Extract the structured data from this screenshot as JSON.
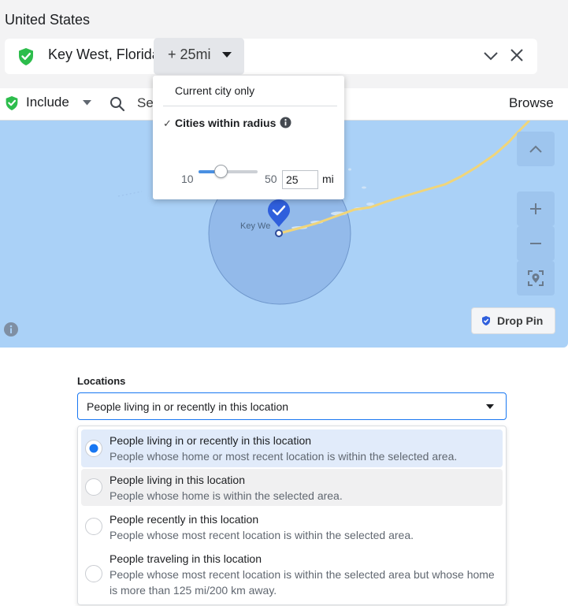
{
  "location_panel": {
    "country": "United States",
    "location_name": "Key West, Florida",
    "radius_label": "+ 25mi"
  },
  "include_bar": {
    "include_label": "Include",
    "search_placeholder": "Se",
    "browse_label": "Browse"
  },
  "radius_popup": {
    "option_city_only": "Current city only",
    "option_radius_check": "✓",
    "option_radius": "Cities within radius",
    "slider_min": "10",
    "slider_max": "50",
    "slider_value": 25,
    "radius_value": "25",
    "unit": "mi"
  },
  "map": {
    "city_label": "Key We",
    "drop_pin_label": "Drop Pin"
  },
  "locations": {
    "heading": "Locations",
    "selected_value": "People living in or recently in this location",
    "options": [
      {
        "title": "People living in or recently in this location",
        "description": "People whose home or most recent location is within the selected area.",
        "selected": true
      },
      {
        "title": "People living in this location",
        "description": "People whose home is within the selected area.",
        "selected": false
      },
      {
        "title": "People recently in this location",
        "description": "People whose most recent location is within the selected area.",
        "selected": false
      },
      {
        "title": "People traveling in this location",
        "description_line1": "People whose most recent location is within the selected area but whose home",
        "description_line2": "is more than 125 mi/200 km away.",
        "selected": false
      }
    ]
  },
  "colors": {
    "accent": "#1877f2",
    "pin_green": "#2dbd4c",
    "map_water": "#aad1f7",
    "selected_option_bg": "#e1ebfa",
    "hover_option_bg": "#f0f0f1"
  }
}
